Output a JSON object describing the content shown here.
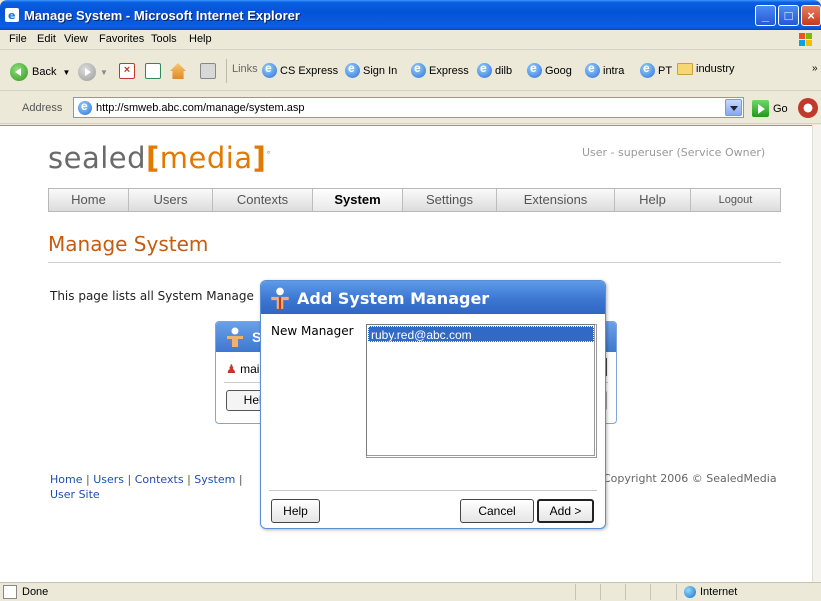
{
  "window": {
    "title": "Manage System - Microsoft Internet Explorer"
  },
  "menu": [
    "File",
    "Edit",
    "View",
    "Favorites",
    "Tools",
    "Help"
  ],
  "toolbar": {
    "back_label": "Back",
    "links_label": "Links",
    "links": [
      "CS Express",
      "Sign In",
      "Express",
      "dilb",
      "Goog",
      "intra",
      "PT"
    ],
    "folder_label": "industry"
  },
  "address": {
    "label": "Address",
    "url": "http://smweb.abc.com/manage/system.asp",
    "go_label": "Go"
  },
  "site": {
    "logo_left": "sealed",
    "logo_open": "[",
    "logo_mid": "media",
    "logo_close": "]",
    "logo_mark": "°",
    "user_info": "User - superuser (Service Owner)",
    "nav": [
      "Home",
      "Users",
      "Contexts",
      "System",
      "Settings",
      "Extensions",
      "Help",
      "Logout"
    ],
    "active_nav": "System",
    "heading": "Manage System",
    "intro": "This page lists all System Manage",
    "bg_panel": {
      "title_fragment": "S",
      "row_fragment": "mai",
      "help_fragment": "Help"
    },
    "footer": {
      "links": [
        "Home",
        "Users",
        "Contexts",
        "System"
      ],
      "trailing_pipe": "|",
      "user_site": "User Site",
      "copyright": "Copyright 2006 © SealedMedia"
    }
  },
  "dialog": {
    "title": "Add System Manager",
    "field_label": "New Manager",
    "options": [
      "ruby.red@abc.com"
    ],
    "help_label": "Help",
    "cancel_label": "Cancel",
    "add_label": "Add >"
  },
  "status": {
    "text": "Done",
    "zone": "Internet"
  },
  "colors": {
    "accent_orange": "#c75b0e",
    "dialog_header": "#3c77d2",
    "selection": "#316ac5",
    "link": "#1c4fb0"
  }
}
